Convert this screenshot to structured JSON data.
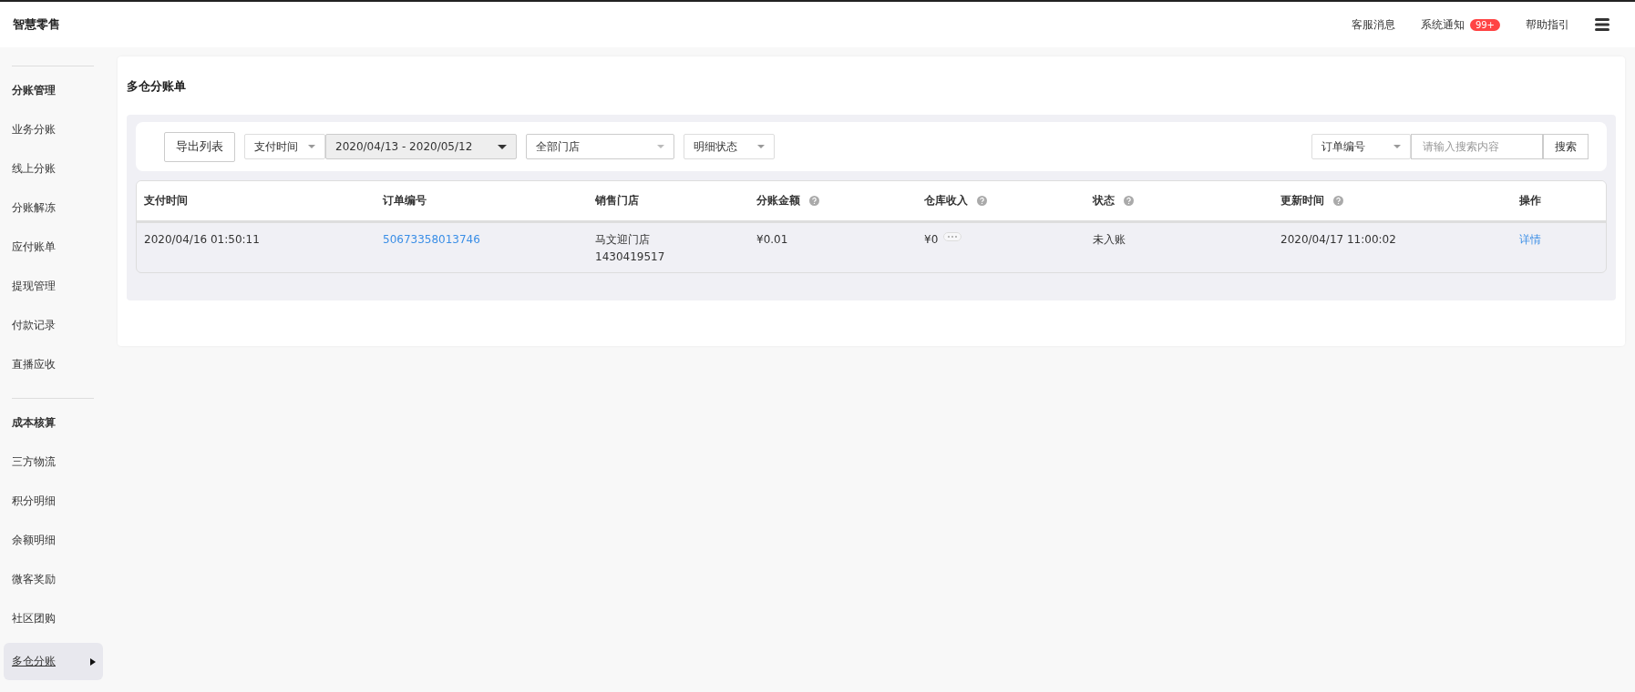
{
  "header": {
    "logo": "智慧零售",
    "links": [
      {
        "label": "客服消息"
      },
      {
        "label": "系统通知",
        "badge": "99+"
      },
      {
        "label": "帮助指引"
      }
    ]
  },
  "sidebar": {
    "groups": [
      {
        "title": "分账管理",
        "items": [
          {
            "label": "业务分账",
            "selected": false
          },
          {
            "label": "线上分账",
            "selected": false
          },
          {
            "label": "分账解冻",
            "selected": false
          },
          {
            "label": "应付账单",
            "selected": false
          },
          {
            "label": "提现管理",
            "selected": false
          },
          {
            "label": "付款记录",
            "selected": false
          },
          {
            "label": "直播应收",
            "selected": false
          }
        ]
      },
      {
        "title": "成本核算",
        "items": [
          {
            "label": "三方物流",
            "selected": false
          },
          {
            "label": "积分明细",
            "selected": false
          },
          {
            "label": "余额明细",
            "selected": false
          },
          {
            "label": "微客奖励",
            "selected": false
          },
          {
            "label": "社区团购",
            "selected": false
          },
          {
            "label": "多仓分账",
            "selected": true
          }
        ]
      }
    ]
  },
  "page": {
    "title": "多仓分账单"
  },
  "filters": {
    "export_button": "导出列表",
    "time_type": "支付时间",
    "date_range": "2020/04/13 - 2020/05/12",
    "store": "全部门店",
    "detail_status": "明细状态",
    "search_type": "订单编号",
    "search_placeholder": "请输入搜索内容",
    "search_button": "搜索"
  },
  "table": {
    "columns": [
      {
        "label": "支付时间",
        "help": false
      },
      {
        "label": "订单编号",
        "help": false
      },
      {
        "label": "销售门店",
        "help": false
      },
      {
        "label": "分账金额",
        "help": true
      },
      {
        "label": "仓库收入",
        "help": true
      },
      {
        "label": "状态",
        "help": true
      },
      {
        "label": "更新时间",
        "help": true
      },
      {
        "label": "操作",
        "help": false
      }
    ],
    "rows": [
      {
        "pay_time": "2020/04/16 01:50:11",
        "order_no": "50673358013746",
        "store_name": "马文迎门店",
        "store_id": "1430419517",
        "amount": "¥0.01",
        "warehouse_income": "¥0",
        "status": "未入账",
        "update_time": "2020/04/17 11:00:02",
        "action": "详情"
      }
    ]
  }
}
